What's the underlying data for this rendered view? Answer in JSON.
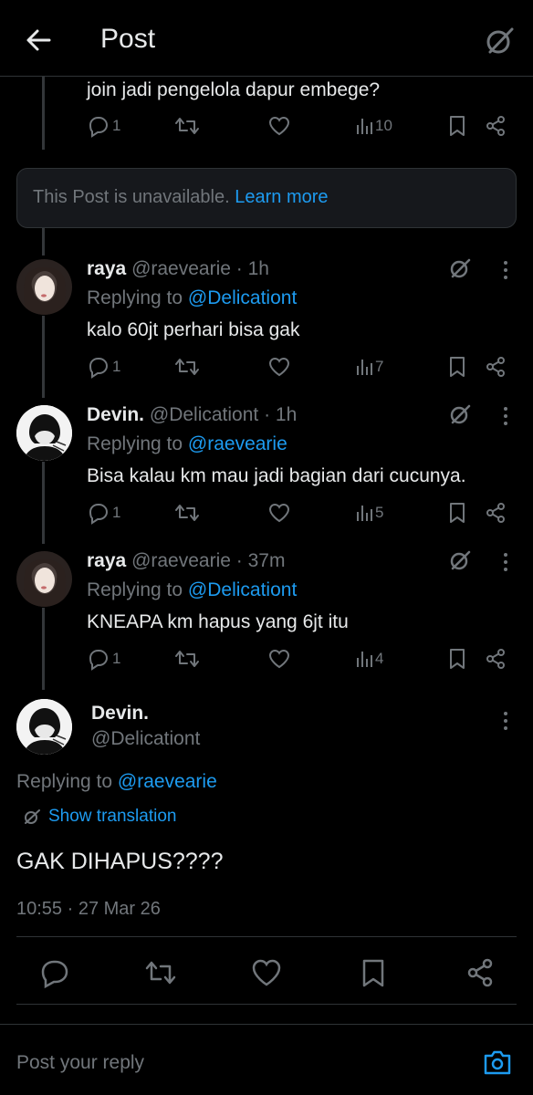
{
  "header": {
    "title": "Post"
  },
  "top_post": {
    "text": "join jadi pengelola dapur embege?",
    "replies": "1",
    "views": "10"
  },
  "unavailable": {
    "text": "This Post is unavailable.",
    "learn_more": "Learn more"
  },
  "replies": [
    {
      "name": "raya",
      "handle": "@raevearie · 1h",
      "replying_prefix": "Replying to",
      "replying_to": "@Delicationt",
      "text": "kalo 60jt perhari bisa gak",
      "replies": "1",
      "views": "7"
    },
    {
      "name": "Devin.",
      "handle": "@Delicationt · 1h",
      "replying_prefix": "Replying to",
      "replying_to": "@raevearie",
      "text": "Bisa kalau km mau jadi bagian dari cucunya.",
      "replies": "1",
      "views": "5"
    },
    {
      "name": "raya",
      "handle": "@raevearie · 37m",
      "replying_prefix": "Replying to",
      "replying_to": "@Delicationt",
      "text": "KNEAPA km hapus yang 6jt itu",
      "replies": "1",
      "views": "4"
    }
  ],
  "main_post": {
    "name": "Devin.",
    "handle": "@Delicationt",
    "replying_prefix": "Replying to",
    "replying_to": "@raevearie",
    "show_translation": "Show translation",
    "text": "GAK DIHAPUS????",
    "timestamp": "10:55 · 27 Mar 26"
  },
  "reply_bar": {
    "placeholder": "Post your reply"
  },
  "colors": {
    "accent": "#1d9bf0",
    "muted": "#71767b",
    "text": "#e7e9ea",
    "background": "#000000"
  }
}
